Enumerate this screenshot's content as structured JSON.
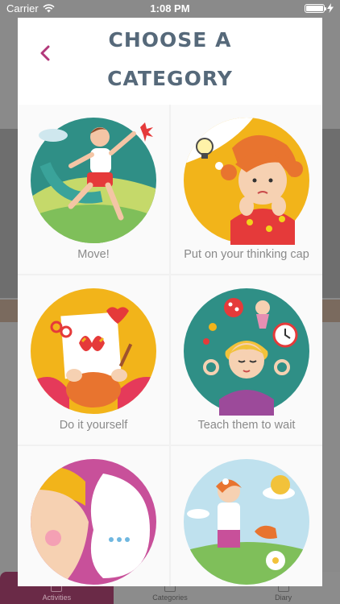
{
  "status_bar": {
    "carrier": "Carrier",
    "time": "1:08 PM",
    "battery_level_percent": 100
  },
  "modal": {
    "title_line1": "CHOOSE A",
    "title_line2": "CATEGORY",
    "back_icon": "chevron-left-icon",
    "accent_color": "#b2387a",
    "title_color": "#56697a"
  },
  "categories": [
    {
      "label": "Move!",
      "icon": "running-child-illustration"
    },
    {
      "label": "Put on your thinking cap",
      "icon": "thinking-girl-illustration"
    },
    {
      "label": "Do it yourself",
      "icon": "crafts-illustration"
    },
    {
      "label": "Teach them to wait",
      "icon": "meditating-girl-illustration"
    },
    {
      "label": "",
      "icon": "talking-child-illustration"
    },
    {
      "label": "",
      "icon": "gardening-girl-illustration"
    }
  ],
  "background_tabbar": {
    "tabs": [
      {
        "label": "Activities"
      },
      {
        "label": "Categories"
      },
      {
        "label": "Diary"
      }
    ]
  }
}
